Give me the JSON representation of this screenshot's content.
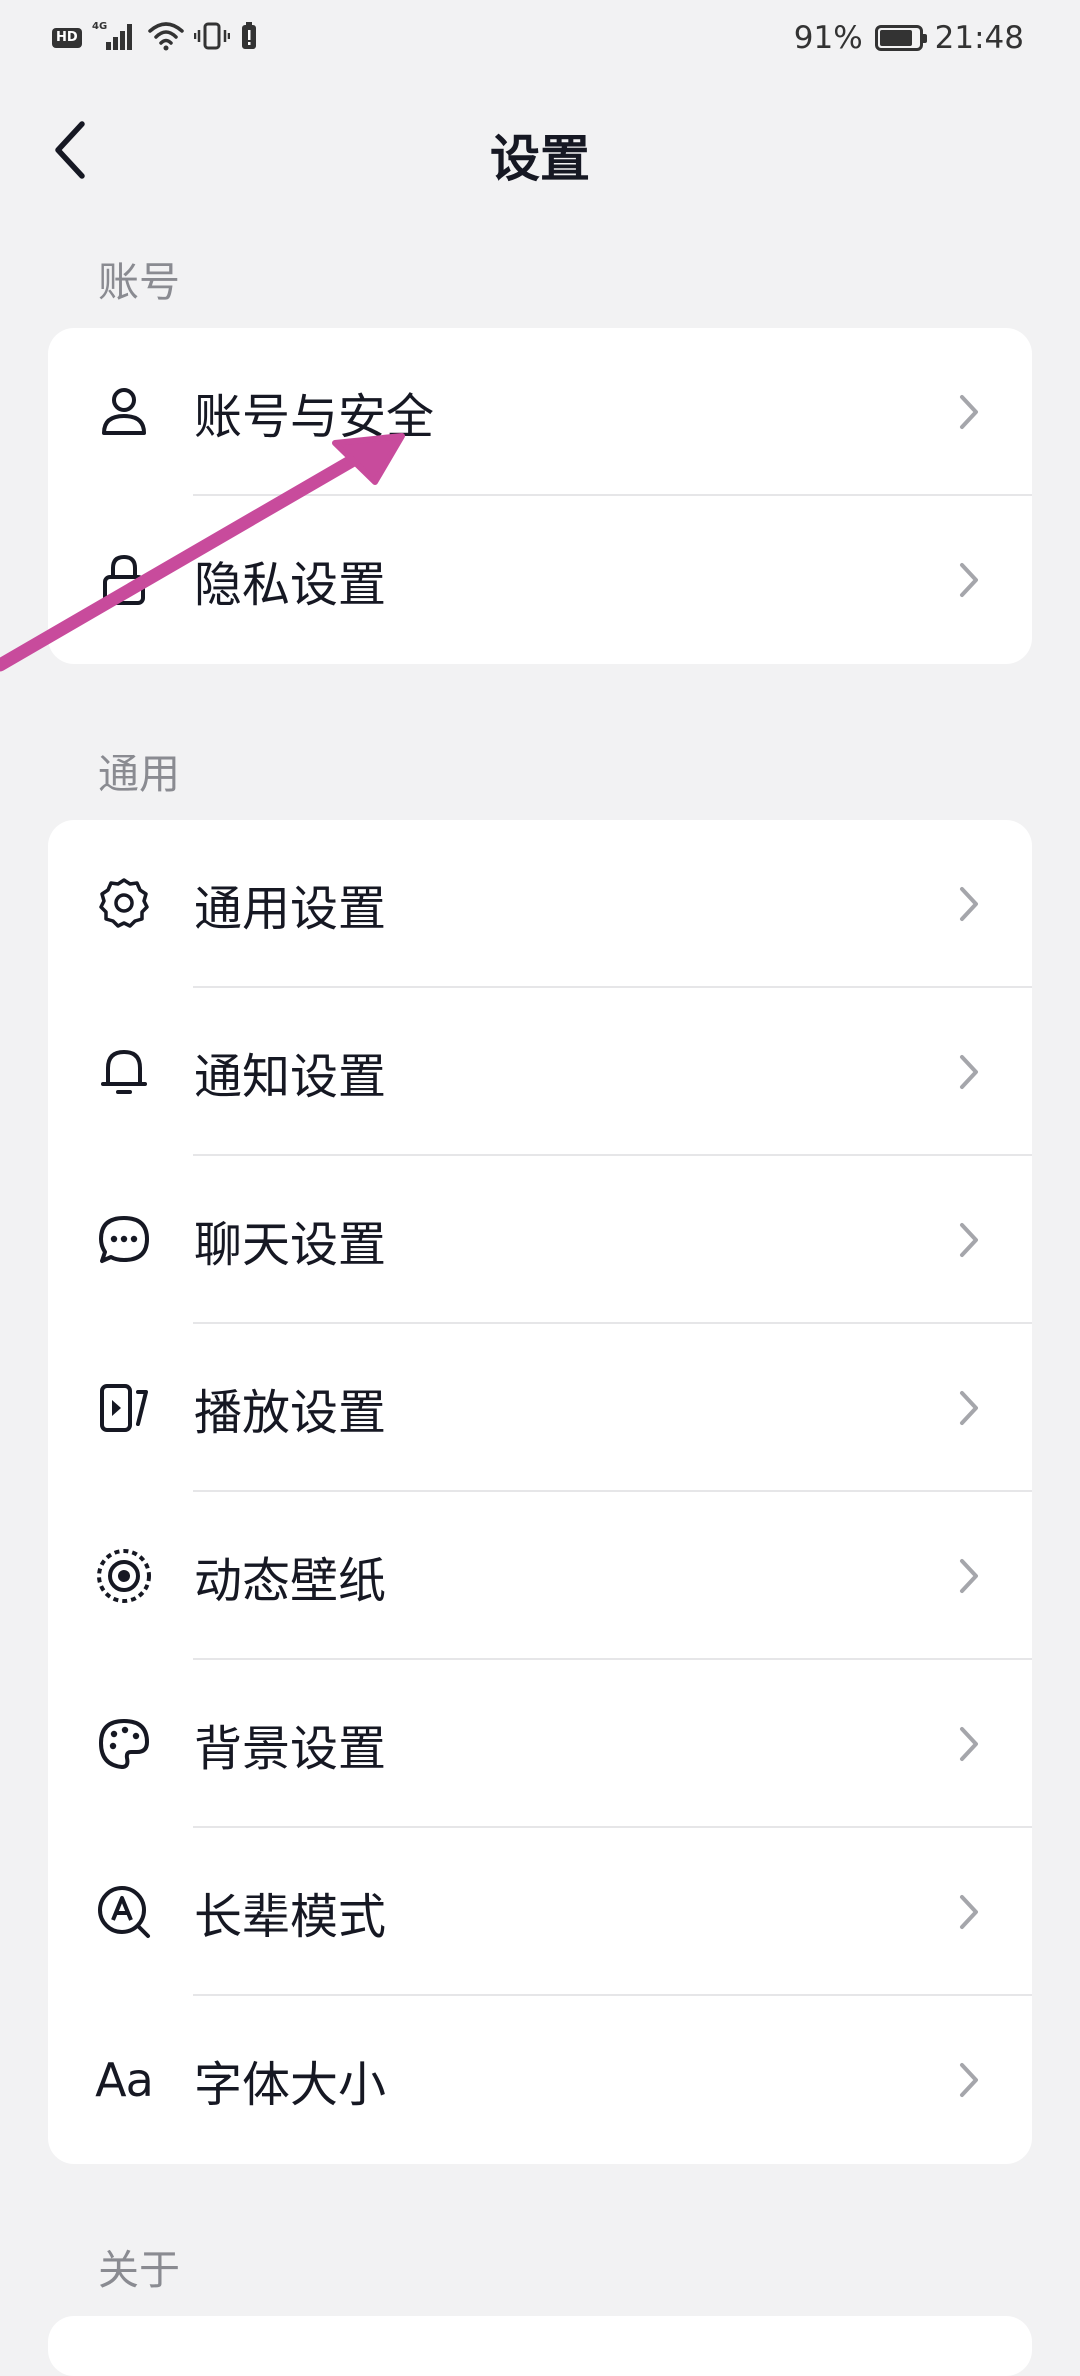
{
  "status_bar": {
    "hd": "HD",
    "network": "4G",
    "battery_percent": "91%",
    "battery_level": 0.91,
    "time": "21:48"
  },
  "header": {
    "title": "设置",
    "back_icon": "chevron-left-icon"
  },
  "sections": {
    "account": {
      "label": "账号",
      "items": [
        {
          "label": "账号与安全",
          "icon": "user-icon"
        },
        {
          "label": "隐私设置",
          "icon": "lock-icon"
        }
      ]
    },
    "general": {
      "label": "通用",
      "items": [
        {
          "label": "通用设置",
          "icon": "gear-icon"
        },
        {
          "label": "通知设置",
          "icon": "bell-icon"
        },
        {
          "label": "聊天设置",
          "icon": "chat-bubble-icon"
        },
        {
          "label": "播放设置",
          "icon": "play-video-icon"
        },
        {
          "label": "动态壁纸",
          "icon": "live-wallpaper-icon"
        },
        {
          "label": "背景设置",
          "icon": "palette-icon"
        },
        {
          "label": "长辈模式",
          "icon": "elder-mode-icon"
        },
        {
          "label": "字体大小",
          "icon": "font-size-icon",
          "icon_text": "Aa"
        }
      ]
    },
    "about": {
      "label": "关于"
    }
  },
  "annotation": {
    "color": "#c84b9c",
    "icon": "arrow-annotation"
  },
  "colors": {
    "background": "#f2f2f3",
    "card": "#ffffff",
    "text": "#161823",
    "section_label": "#8a8b91",
    "chevron": "#a5a6ab"
  }
}
